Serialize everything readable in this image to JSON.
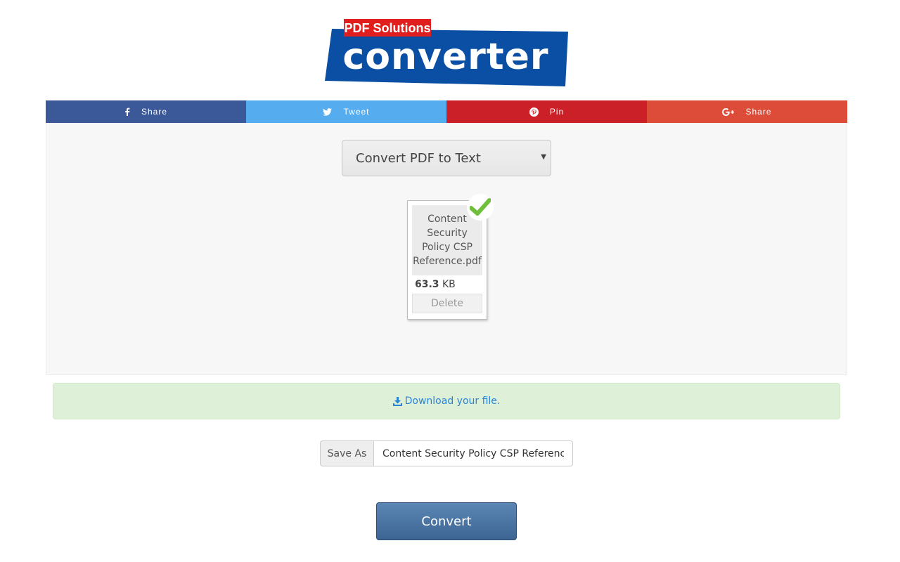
{
  "logo": {
    "badge_text": "PDF Solutions",
    "word": "converter",
    "brand_blue": "#0a4fa3",
    "badge_red": "#e01e1e"
  },
  "share": [
    {
      "label": "Share",
      "icon": "facebook-icon",
      "color": "#3b5998"
    },
    {
      "label": "Tweet",
      "icon": "twitter-icon",
      "color": "#55acee"
    },
    {
      "label": "Pin",
      "icon": "pinterest-icon",
      "color": "#cb2027"
    },
    {
      "label": "Share",
      "icon": "google-plus-icon",
      "color": "#dd4b39"
    }
  ],
  "converter": {
    "selected_option": "Convert PDF to Text"
  },
  "file": {
    "name": "Content Security Policy CSP Reference.pdf",
    "size_value": "63.3",
    "size_unit": "KB",
    "delete_label": "Delete",
    "status": "check-icon"
  },
  "download": {
    "label": "Download your file.",
    "icon": "download-icon"
  },
  "save_as": {
    "label": "Save As",
    "value": "Content Security Policy CSP Reference"
  },
  "convert_label": "Convert",
  "colors": {
    "success_bg": "#dff0d8",
    "link": "#2a84d6",
    "convert": "#4a73a2"
  }
}
